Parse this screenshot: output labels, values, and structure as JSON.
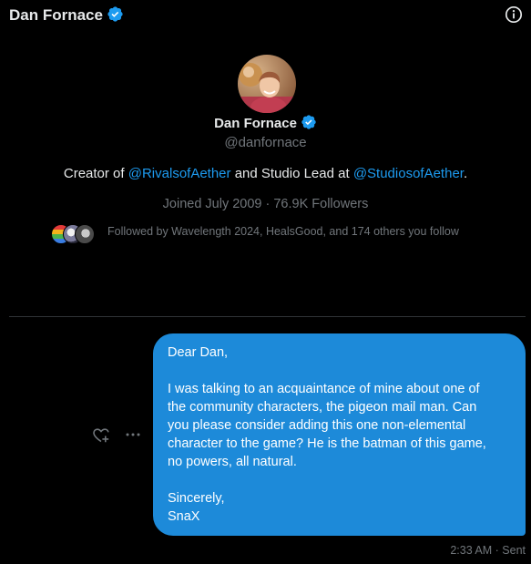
{
  "header": {
    "name": "Dan Fornace",
    "verified_icon": "verified-badge-icon",
    "info_icon": "info-icon"
  },
  "profile": {
    "avatar_icon": "profile-avatar",
    "name": "Dan Fornace",
    "handle": "@danfornace",
    "bio": {
      "prefix": "Creator of ",
      "mention1": "@RivalsofAether",
      "middle": " and Studio Lead at ",
      "mention2": "@StudiosofAether",
      "suffix": "."
    },
    "joined": "Joined July 2009 · 76.9K Followers",
    "followed_by": "Followed by Wavelength 2024, HealsGood, and 174 others you follow"
  },
  "message": {
    "greeting": "Dear Dan,",
    "body": "I was talking to an acquaintance of mine about one of\nthe community characters, the pigeon mail man. Can\nyou please consider adding this one non-elemental\ncharacter to the game? He is the batman of this game,\nno powers, all natural.",
    "closing": "Sincerely,\nSnaX",
    "time": "2:33 AM · Sent"
  },
  "actions": {
    "react_icon": "add-reaction-heart-icon",
    "more_icon": "more-options-icon"
  },
  "colors": {
    "background": "#000000",
    "accent": "#1d9bf0",
    "bubble": "#1d8ad9",
    "secondary_text": "#71767b",
    "divider": "#2f3336"
  }
}
